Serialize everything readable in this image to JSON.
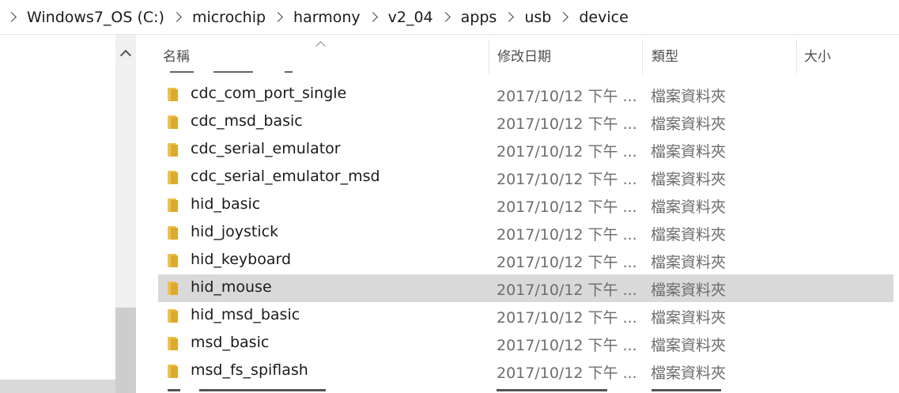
{
  "breadcrumb": [
    "Windows7_OS (C:)",
    "microchip",
    "harmony",
    "v2_04",
    "apps",
    "usb",
    "device"
  ],
  "columns": {
    "name": "名稱",
    "date": "修改日期",
    "type": "類型",
    "size": "大小"
  },
  "rows": [
    {
      "name": "cdc_com_port_single",
      "date": "2017/10/12 下午 ...",
      "type": "檔案資料夾"
    },
    {
      "name": "cdc_msd_basic",
      "date": "2017/10/12 下午 ...",
      "type": "檔案資料夾"
    },
    {
      "name": "cdc_serial_emulator",
      "date": "2017/10/12 下午 ...",
      "type": "檔案資料夾"
    },
    {
      "name": "cdc_serial_emulator_msd",
      "date": "2017/10/12 下午 ...",
      "type": "檔案資料夾"
    },
    {
      "name": "hid_basic",
      "date": "2017/10/12 下午 ...",
      "type": "檔案資料夾"
    },
    {
      "name": "hid_joystick",
      "date": "2017/10/12 下午 ...",
      "type": "檔案資料夾"
    },
    {
      "name": "hid_keyboard",
      "date": "2017/10/12 下午 ...",
      "type": "檔案資料夾"
    },
    {
      "name": "hid_mouse",
      "date": "2017/10/12 下午 ...",
      "type": "檔案資料夾",
      "selected": true
    },
    {
      "name": "hid_msd_basic",
      "date": "2017/10/12 下午 ...",
      "type": "檔案資料夾"
    },
    {
      "name": "msd_basic",
      "date": "2017/10/12 下午 ...",
      "type": "檔案資料夾"
    },
    {
      "name": "msd_fs_spiflash",
      "date": "2017/10/12 下午 ...",
      "type": "檔案資料夾"
    }
  ],
  "icons": {
    "folder": "folder-icon",
    "separator": "chevron-right-icon",
    "sort": "sort-ascending-icon",
    "scroll_up": "chevron-up-icon"
  },
  "colors": {
    "selection": "#d9d9d9",
    "folder": "#f0c14b"
  }
}
